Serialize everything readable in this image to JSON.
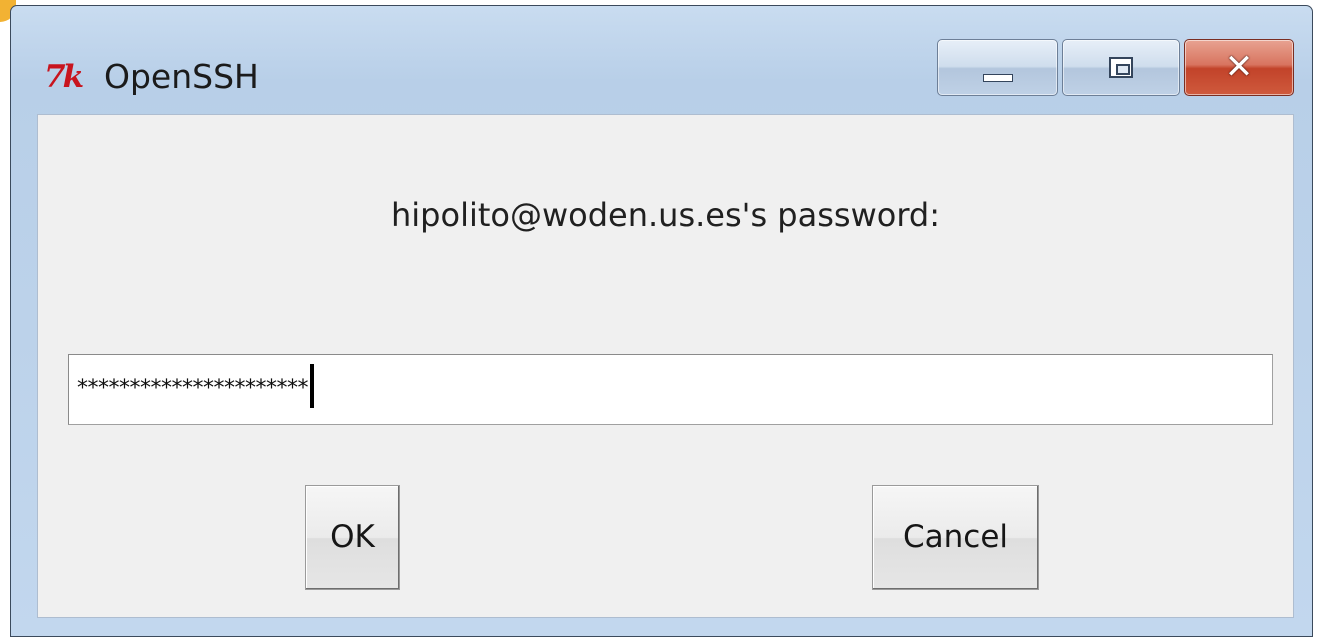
{
  "window": {
    "app_icon": "tk-feather-icon",
    "icon_glyph": "7k",
    "title": "OpenSSH",
    "controls": {
      "minimize_icon": "minimize-icon",
      "maximize_icon": "maximize-icon",
      "close_icon": "close-icon",
      "close_glyph": "✕"
    }
  },
  "dialog": {
    "prompt": "hipolito@woden.us.es's password:",
    "password": {
      "masked_value": "**********************"
    },
    "buttons": {
      "ok_label": "OK",
      "cancel_label": "Cancel"
    }
  },
  "colors": {
    "accent_corner": "#f2b233",
    "tk_icon_red": "#c8141e",
    "close_button_red": "#c2432a",
    "titlebar_blue": "#bcd2ea",
    "client_background": "#f0f0f0"
  }
}
